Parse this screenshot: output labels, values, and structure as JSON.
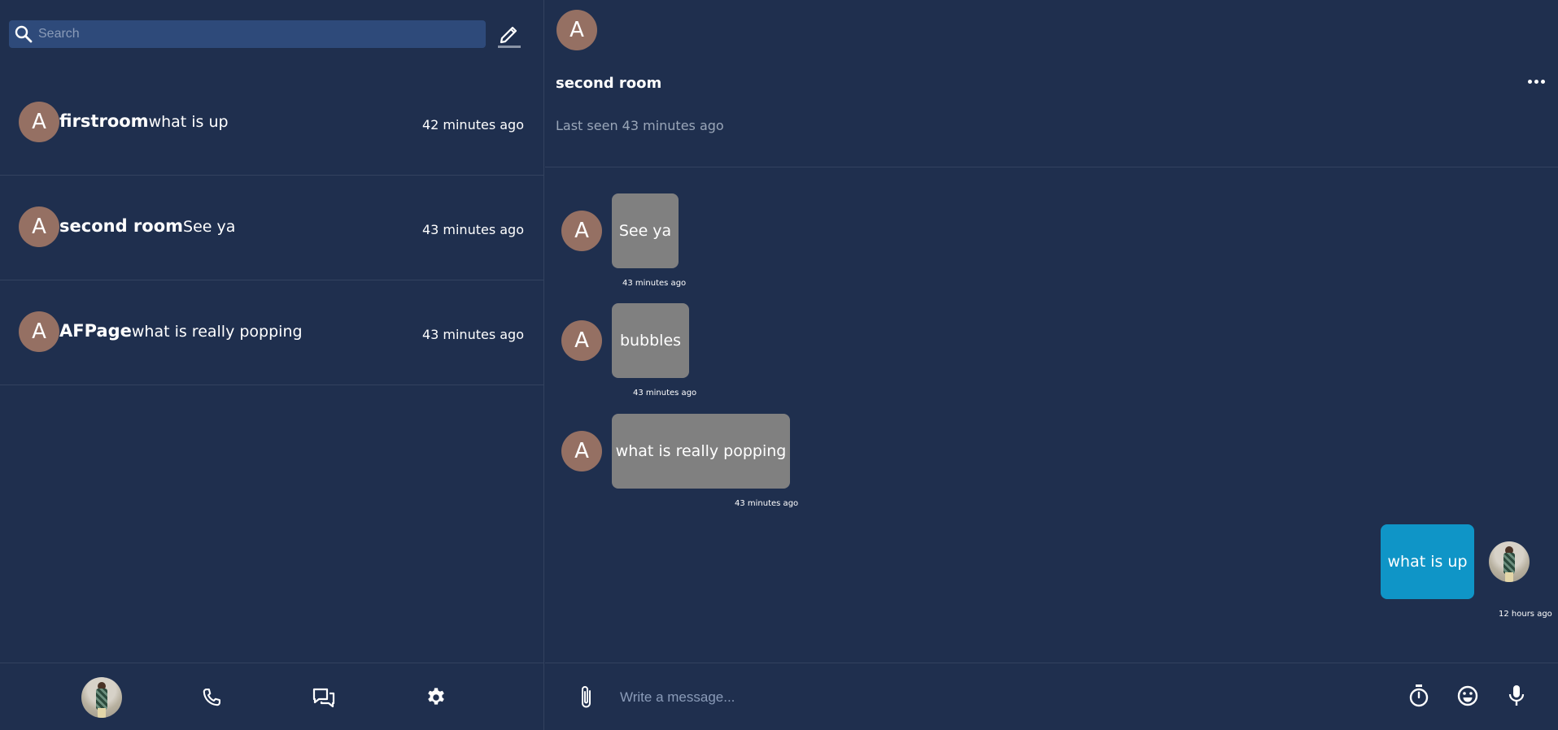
{
  "sidebar": {
    "search": {
      "placeholder": "Search",
      "value": ""
    },
    "rooms": [
      {
        "avatar_letter": "A",
        "name": "firstroom",
        "last_message": "what is up",
        "time": "42 minutes ago"
      },
      {
        "avatar_letter": "A",
        "name": "second room",
        "last_message": "See ya",
        "time": "43 minutes ago"
      },
      {
        "avatar_letter": "A",
        "name": "AFPage",
        "last_message": "what is really popping",
        "time": "43 minutes ago"
      }
    ],
    "nav_icons": [
      "profile-avatar",
      "phone-icon",
      "chat-icon",
      "gear-icon"
    ]
  },
  "chat": {
    "avatar_letter": "A",
    "title": "second room",
    "last_seen": "Last seen 43 minutes ago",
    "messages": [
      {
        "sender": "other",
        "avatar_letter": "A",
        "text": "See ya",
        "time": "43 minutes ago"
      },
      {
        "sender": "other",
        "avatar_letter": "A",
        "text": "bubbles",
        "time": "43 minutes ago"
      },
      {
        "sender": "other",
        "avatar_letter": "A",
        "text": "what is really popping",
        "time": "43 minutes ago"
      },
      {
        "sender": "me",
        "text": "what is up",
        "time": "12 hours ago"
      }
    ],
    "composer": {
      "placeholder": "Write a message...",
      "value": ""
    }
  },
  "colors": {
    "background": "#1f2f4e",
    "search_bg": "#2e4a7a",
    "avatar_bg": "#957063",
    "bubble_other": "#808080",
    "bubble_mine": "#0f95c7"
  }
}
